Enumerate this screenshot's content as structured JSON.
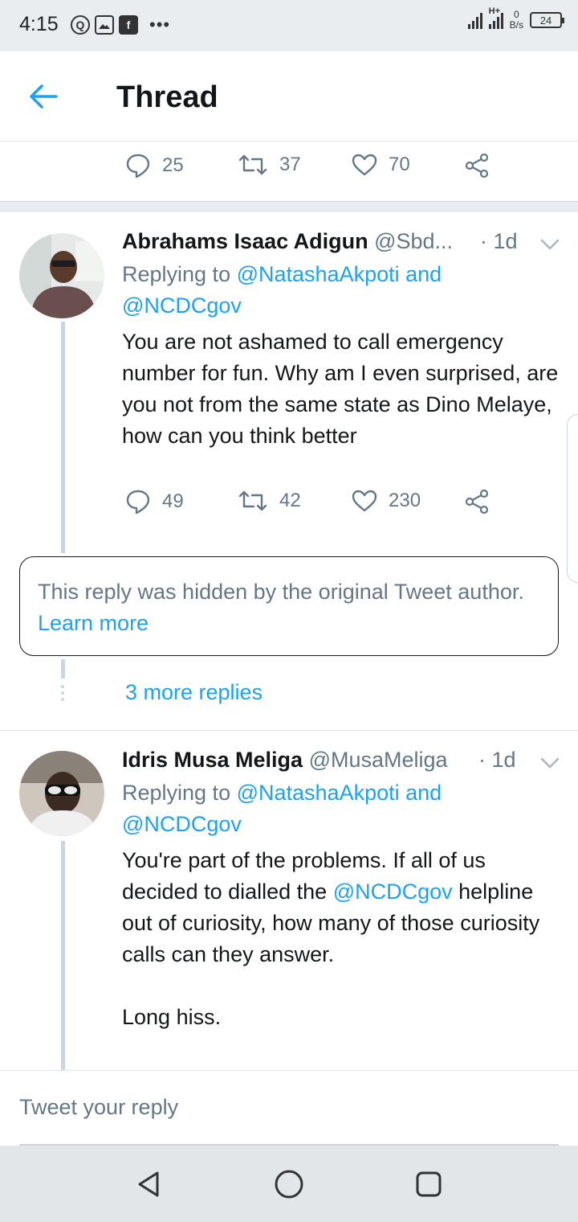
{
  "status_bar": {
    "time": "4:15",
    "network_type": "H+",
    "speed_value": "0",
    "speed_unit": "B/s",
    "battery": "24"
  },
  "header": {
    "title": "Thread",
    "back_icon": "arrow-left-icon"
  },
  "top_actions": {
    "replies": "25",
    "retweets": "37",
    "likes": "70"
  },
  "tweets": [
    {
      "name": "Abrahams Isaac Adigun",
      "handle": "@Sbd...",
      "time": "· 1d",
      "replying_prefix": "Replying to ",
      "replying_to_1": "@NatashaAkpoti",
      "replying_and": " and",
      "replying_to_2": "@NCDCgov",
      "body": "You are not ashamed to call emergency number for fun. Why am I even surprised, are you not from the same state as Dino Melaye, how can you think better",
      "replies": "49",
      "retweets": "42",
      "likes": "230"
    },
    {
      "name": "Idris Musa Meliga",
      "handle": "@MusaMeliga",
      "time": "· 1d",
      "replying_prefix": "Replying to ",
      "replying_to_1": "@NatashaAkpoti",
      "replying_and": " and",
      "replying_to_2": "@NCDCgov",
      "body_part1": "You're part of the problems. If all of us decided to dialled the ",
      "body_mention": "@NCDCgov",
      "body_part2": " helpline out of curiosity, how many of those curiosity calls can they answer.",
      "body_part3": "Long hiss."
    }
  ],
  "hidden_notice": {
    "text": "This reply was hidden by the original Tweet author. ",
    "link": "Learn more"
  },
  "more_replies": "3 more replies",
  "reply_box": {
    "placeholder": "Tweet your reply"
  },
  "colors": {
    "accent": "#1da1f2",
    "secondary_text": "#657786",
    "divider": "#e1e8ed"
  }
}
